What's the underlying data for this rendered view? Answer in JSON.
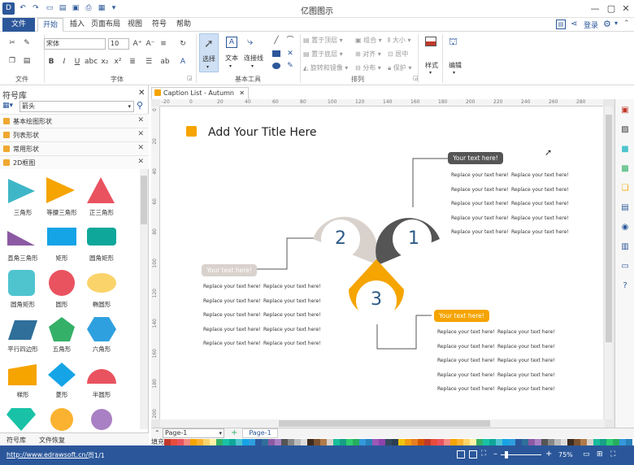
{
  "app": {
    "title": "亿图图示"
  },
  "tabs": [
    "文件",
    "开始",
    "插入",
    "页面布局",
    "视图",
    "符号",
    "帮助"
  ],
  "account": {
    "login": "登录"
  },
  "ribbon": {
    "groups": [
      "文件",
      "字体",
      "基本工具",
      "排列",
      "样式",
      "编辑"
    ],
    "font_name": "宋体",
    "font_size": "10",
    "tools": {
      "select": "选择",
      "text": "文本",
      "connector": "连接线"
    },
    "arrange": {
      "bring_front": "置于顶层",
      "send_back": "置于底层",
      "rotate": "旋转和镜像",
      "group": "组合",
      "align": "对齐",
      "distribute": "分布",
      "size": "大小",
      "center": "居中",
      "protect": "保护"
    },
    "style_label": "样式",
    "edit_label": "编辑"
  },
  "library": {
    "title": "符号库",
    "search_value": "箭头",
    "categories": [
      "基本绘图形状",
      "列表形状",
      "常用形状",
      "2D框图"
    ],
    "shapes": [
      [
        "三角形",
        "等腰三角形",
        "正三角形"
      ],
      [
        "直角三角形",
        "矩形",
        "圆角矩形"
      ],
      [
        "圆角矩形",
        "圆形",
        "椭圆形"
      ],
      [
        "平行四边形",
        "五角形",
        "六角形"
      ],
      [
        "梯形",
        "菱形",
        "半圆形"
      ]
    ],
    "bottom_tabs": [
      "符号库",
      "文件恢复"
    ]
  },
  "document": {
    "tab": "Caption List - Autumn"
  },
  "rulers": {
    "h": [
      "-20",
      "0",
      "20",
      "40",
      "60",
      "80",
      "100",
      "120",
      "140",
      "160",
      "180",
      "200",
      "220",
      "240",
      "260",
      "280"
    ],
    "v": [
      "0",
      "20",
      "40",
      "60",
      "80",
      "100",
      "120",
      "140",
      "160",
      "180",
      "200"
    ]
  },
  "diagram": {
    "title": "Add Your Title Here",
    "circles": [
      "1",
      "2",
      "3"
    ],
    "captions": [
      "Your text here!",
      "Your text here!",
      "Your text here!"
    ],
    "body_text": "Replace your text here!",
    "colors": {
      "dark": "#555555",
      "gray": "#d9d2cc",
      "orange": "#f5a400",
      "title_square": "#f5a400",
      "number": "#2d5b86"
    }
  },
  "pages": {
    "current": "Page-1",
    "tab": "Page-1"
  },
  "palette_label": "填充",
  "status": {
    "url": "http://www.edrawsoft.cn/",
    "page": "页1/1",
    "zoom": "75%"
  }
}
